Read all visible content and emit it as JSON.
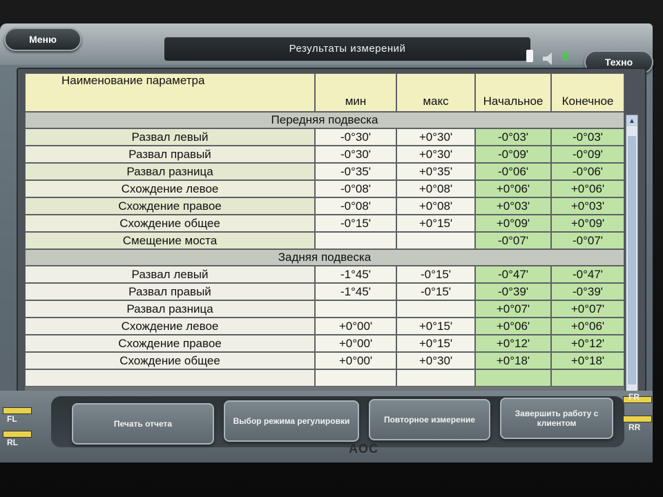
{
  "header": {
    "title": "Результаты измерений",
    "menu_label": "Меню",
    "tech_label": "Техно",
    "volume_level": "8",
    "sound_icon": "speaker-icon"
  },
  "table": {
    "columns": [
      "Наименование параметра",
      "мин",
      "макс",
      "Начальное",
      "Конечное"
    ],
    "sections": [
      {
        "title": "Передняя подвеска",
        "rows": [
          {
            "name": "Развал левый",
            "min": "-0°30'",
            "max": "+0°30'",
            "initial": "-0°03'",
            "final": "-0°03'"
          },
          {
            "name": "Развал правый",
            "min": "-0°30'",
            "max": "+0°30'",
            "initial": "-0°09'",
            "final": "-0°09'"
          },
          {
            "name": "Развал разница",
            "min": "-0°35'",
            "max": "+0°35'",
            "initial": "-0°06'",
            "final": "-0°06'"
          },
          {
            "name": "Схождение левое",
            "min": "-0°08'",
            "max": "+0°08'",
            "initial": "+0°06'",
            "final": "+0°06'"
          },
          {
            "name": "Схождение правое",
            "min": "-0°08'",
            "max": "+0°08'",
            "initial": "+0°03'",
            "final": "+0°03'"
          },
          {
            "name": "Схождение общее",
            "min": "-0°15'",
            "max": "+0°15'",
            "initial": "+0°09'",
            "final": "+0°09'"
          },
          {
            "name": "Смещение моста",
            "min": "",
            "max": "",
            "initial": "-0°07'",
            "final": "-0°07'"
          }
        ]
      },
      {
        "title": "Задняя подвеска",
        "rows": [
          {
            "name": "Развал левый",
            "min": "-1°45'",
            "max": "-0°15'",
            "initial": "-0°47'",
            "final": "-0°47'"
          },
          {
            "name": "Развал правый",
            "min": "-1°45'",
            "max": "-0°15'",
            "initial": "-0°39'",
            "final": "-0°39'"
          },
          {
            "name": "Развал разница",
            "min": "",
            "max": "",
            "initial": "+0°07'",
            "final": "+0°07'"
          },
          {
            "name": "Схождение левое",
            "min": "+0°00'",
            "max": "+0°15'",
            "initial": "+0°06'",
            "final": "+0°06'"
          },
          {
            "name": "Схождение правое",
            "min": "+0°00'",
            "max": "+0°15'",
            "initial": "+0°12'",
            "final": "+0°12'"
          },
          {
            "name": "Схождение общее",
            "min": "+0°00'",
            "max": "+0°30'",
            "initial": "+0°18'",
            "final": "+0°18'"
          }
        ]
      }
    ]
  },
  "footer": {
    "print_label": "Печать отчета",
    "mode_label": "Выбор режима регулировки",
    "remeasure_label": "Повторное измерение",
    "finish_label": "Завершить работу с клиентом",
    "wheel_labels": [
      "FL",
      "RL",
      "FR",
      "RR"
    ]
  },
  "monitor": {
    "brand": "AOC"
  },
  "colors": {
    "in_range": "#bfe3a6",
    "header": "#f3f0c0",
    "title_bar": "#1d2124",
    "accent_green": "#3fd43f"
  }
}
